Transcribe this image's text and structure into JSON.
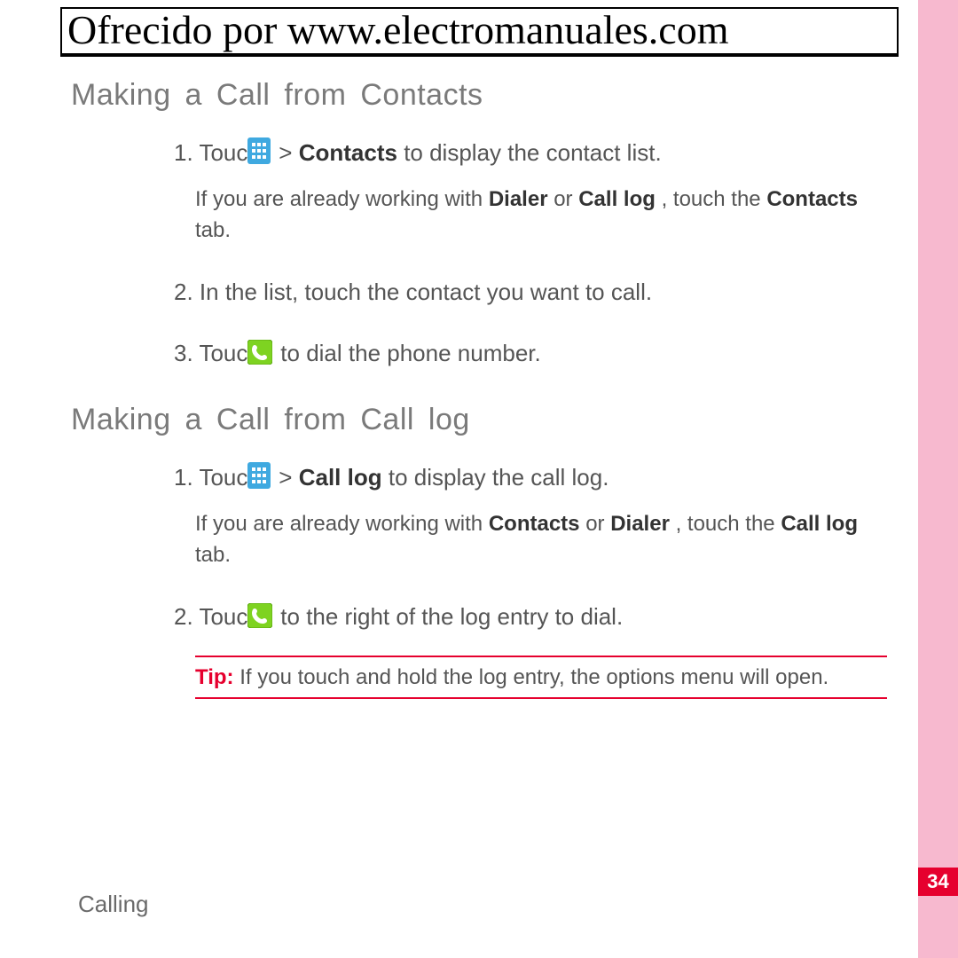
{
  "header": {
    "banner": "Ofrecido por www.electromanuales.com"
  },
  "sections": {
    "a": {
      "title": "Making  a  Call  from  Contacts",
      "step1_prefix": "1. Touch ",
      "step1_mid": " > ",
      "step1_bold": "Contacts",
      "step1_suffix": " to display the contact list.",
      "step1_sub_pre": "If you are already working with ",
      "step1_sub_b1": "Dialer",
      "step1_sub_mid": " or ",
      "step1_sub_b2": "Call log",
      "step1_sub_mid2": ", touch the ",
      "step1_sub_b3": "Contacts",
      "step1_sub_end": " tab.",
      "step2": "2. In the list, touch the contact you want to call.",
      "step3_prefix": "3. Touch ",
      "step3_suffix": " to dial the phone number."
    },
    "b": {
      "title": "Making  a  Call  from  Call  log",
      "step1_prefix": "1. Touch ",
      "step1_mid": " > ",
      "step1_bold": "Call log",
      "step1_suffix": " to display the call log.",
      "step1_sub_pre": "If you are already working with ",
      "step1_sub_b1": "Contacts",
      "step1_sub_mid": " or ",
      "step1_sub_b2": "Dialer",
      "step1_sub_mid2": ", touch the ",
      "step1_sub_b3": "Call log",
      "step1_sub_end": " tab.",
      "step2_prefix": "2. Touch ",
      "step2_suffix": " to the right of the log entry to dial."
    }
  },
  "tip": {
    "label": "Tip:  ",
    "text": "If you touch and hold the log entry, the options menu will open."
  },
  "footer": {
    "chapter": "Calling",
    "page": "34"
  }
}
